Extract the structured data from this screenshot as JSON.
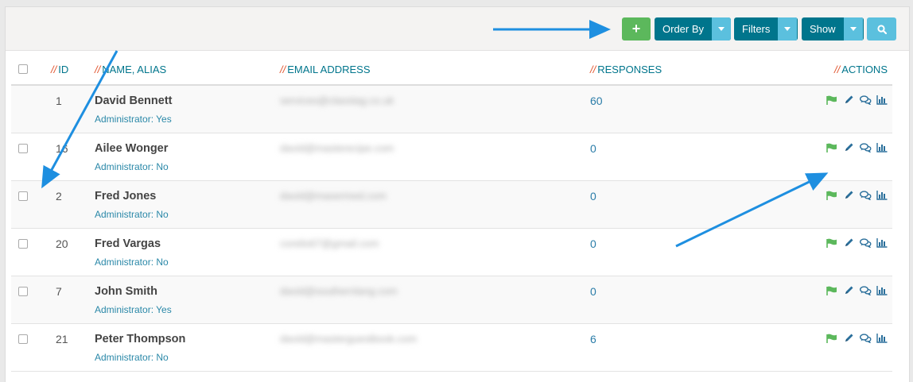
{
  "toolbar": {
    "add_label": "+",
    "order_by_label": "Order By",
    "filters_label": "Filters",
    "show_label": "Show"
  },
  "table": {
    "headers": {
      "prefix": "//",
      "id": "ID",
      "name": "NAME, ALIAS",
      "email": "EMAIL ADDRESS",
      "responses": "RESPONSES",
      "actions": "ACTIONS"
    },
    "rows": [
      {
        "id": "1",
        "name": "David Bennett",
        "admin": "Administrator: Yes",
        "email": "services@classtag.co.uk",
        "responses": "60",
        "has_checkbox": false
      },
      {
        "id": "16",
        "name": "Ailee Wonger",
        "admin": "Administrator: No",
        "email": "david@masterecipe.com",
        "responses": "0",
        "has_checkbox": true
      },
      {
        "id": "2",
        "name": "Fred Jones",
        "admin": "Administrator: No",
        "email": "david@masermed.com",
        "responses": "0",
        "has_checkbox": true
      },
      {
        "id": "20",
        "name": "Fred Vargas",
        "admin": "Administrator: No",
        "email": "corelis67@gmail.com",
        "responses": "0",
        "has_checkbox": true
      },
      {
        "id": "7",
        "name": "John Smith",
        "admin": "Administrator: Yes",
        "email": "david@southernlang.com",
        "responses": "0",
        "has_checkbox": true
      },
      {
        "id": "21",
        "name": "Peter Thompson",
        "admin": "Administrator: No",
        "email": "david@masterguestbook.com",
        "responses": "6",
        "has_checkbox": true
      }
    ]
  },
  "icons": [
    "flag-icon",
    "pencil-icon",
    "comments-icon",
    "bar-chart-icon",
    "search-icon",
    "caret-down-icon"
  ],
  "colors": {
    "teal": "#00758c",
    "green": "#5cb85c",
    "light_blue": "#5bc0de",
    "red_accent": "#e0532c",
    "arrow": "#1e8fe0"
  }
}
